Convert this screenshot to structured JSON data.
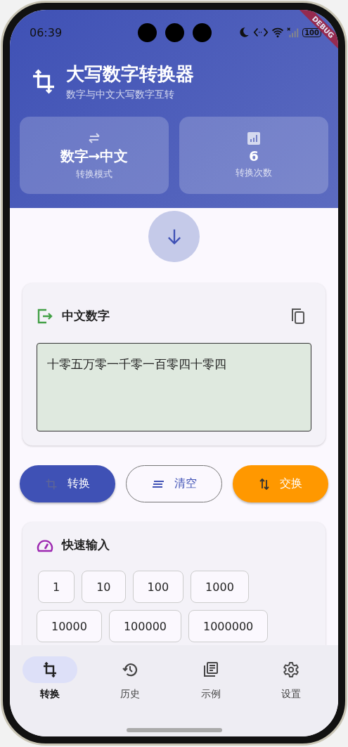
{
  "status_bar": {
    "time": "06:39",
    "battery": "100"
  },
  "debug_banner": "DEBUG",
  "header": {
    "title": "大写数字转换器",
    "subtitle": "数字与中文大写数字互转"
  },
  "stats": [
    {
      "kind": "mode",
      "value": "数字→中文",
      "label": "转换模式"
    },
    {
      "kind": "count",
      "value": "6",
      "label": "转换次数"
    }
  ],
  "output_card": {
    "title": "中文数字",
    "value": "十零五万零一千零一百零四十零四"
  },
  "buttons": [
    {
      "kind": "convert",
      "label": "转换"
    },
    {
      "kind": "clear",
      "label": "清空"
    },
    {
      "kind": "swap",
      "label": "交换"
    }
  ],
  "quick_input": {
    "title": "快速输入",
    "chips": [
      [
        "1",
        "10",
        "100",
        "1000"
      ],
      [
        "10000",
        "100000",
        "1000000"
      ]
    ]
  },
  "nav": [
    {
      "kind": "convert",
      "label": "转换",
      "selected": true
    },
    {
      "kind": "history",
      "label": "历史",
      "selected": false
    },
    {
      "kind": "examples",
      "label": "示例",
      "selected": false
    },
    {
      "kind": "settings",
      "label": "设置",
      "selected": false
    }
  ]
}
